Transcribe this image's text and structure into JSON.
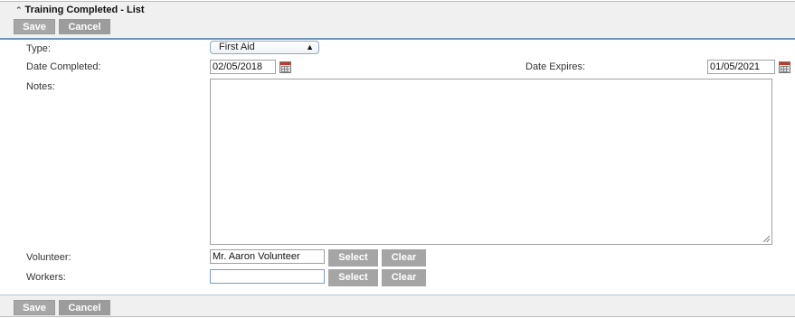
{
  "header": {
    "title": "Training Completed  -  List",
    "save_label": "Save",
    "cancel_label": "Cancel"
  },
  "form": {
    "type_label": "Type:",
    "type_value": "First Aid",
    "date_completed_label": "Date Completed:",
    "date_completed_value": "02/05/2018",
    "date_expires_label": "Date Expires:",
    "date_expires_value": "01/05/2021",
    "notes_label": "Notes:",
    "notes_value": "",
    "volunteer_label": "Volunteer:",
    "volunteer_value": "Mr. Aaron Volunteer",
    "workers_label": "Workers:",
    "workers_value": "",
    "select_label": "Select",
    "clear_label": "Clear"
  },
  "footer": {
    "save_label": "Save",
    "cancel_label": "Cancel"
  },
  "colors": {
    "accent_line": "#6f96b8",
    "button_bg": "#a7a7a7",
    "bar_bg": "#f0f0f0"
  },
  "icons": [
    "collapse-chevron-icon",
    "calendar-icon"
  ]
}
